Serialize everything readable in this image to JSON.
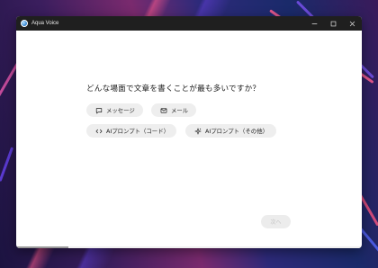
{
  "window": {
    "title": "Aqua Voice"
  },
  "question": "どんな場面で文章を書くことが最も多いですか？",
  "options": [
    {
      "label": "メッセージ",
      "icon": "chat-icon"
    },
    {
      "label": "メール",
      "icon": "mail-icon"
    },
    {
      "label": "AIプロンプト（コード）",
      "icon": "code-icon"
    },
    {
      "label": "AIプロンプト（その他）",
      "icon": "sparkle-icon"
    }
  ],
  "next_label": "次へ",
  "progress": 0.15
}
